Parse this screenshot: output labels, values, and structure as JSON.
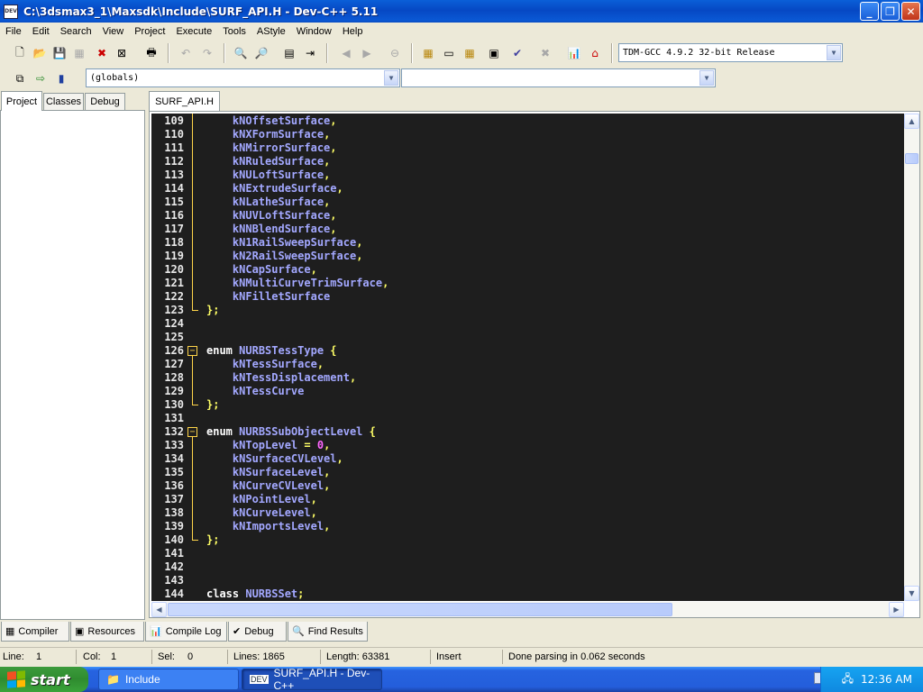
{
  "window": {
    "title": "C:\\3dsmax3_1\\Maxsdk\\Include\\SURF_API.H - Dev-C++ 5.11",
    "app_icon_label": "DEV"
  },
  "menu": [
    "File",
    "Edit",
    "Search",
    "View",
    "Project",
    "Execute",
    "Tools",
    "AStyle",
    "Window",
    "Help"
  ],
  "toolbar": {
    "compiler_select": "TDM-GCC 4.9.2 32-bit Release",
    "globals_select": "(globals)",
    "function_select": ""
  },
  "left_panel": {
    "tabs": [
      "Project",
      "Classes",
      "Debug"
    ],
    "active": "Project"
  },
  "editor": {
    "tab": "SURF_API.H",
    "lines": [
      {
        "n": "109",
        "text": "    kNOffsetSurface,"
      },
      {
        "n": "110",
        "text": "    kNXFormSurface,"
      },
      {
        "n": "111",
        "text": "    kNMirrorSurface,"
      },
      {
        "n": "112",
        "text": "    kNRuledSurface,"
      },
      {
        "n": "113",
        "text": "    kNULoftSurface,"
      },
      {
        "n": "114",
        "text": "    kNExtrudeSurface,"
      },
      {
        "n": "115",
        "text": "    kNLatheSurface,"
      },
      {
        "n": "116",
        "text": "    kNUVLoftSurface,"
      },
      {
        "n": "117",
        "text": "    kNNBlendSurface,"
      },
      {
        "n": "118",
        "text": "    kN1RailSweepSurface,"
      },
      {
        "n": "119",
        "text": "    kN2RailSweepSurface,"
      },
      {
        "n": "120",
        "text": "    kNCapSurface,"
      },
      {
        "n": "121",
        "text": "    kNMultiCurveTrimSurface,"
      },
      {
        "n": "122",
        "text": "    kNFilletSurface"
      },
      {
        "n": "123",
        "text": "};"
      },
      {
        "n": "124",
        "text": ""
      },
      {
        "n": "125",
        "text": ""
      },
      {
        "n": "126",
        "text": "enum NURBSTessType {"
      },
      {
        "n": "127",
        "text": "    kNTessSurface,"
      },
      {
        "n": "128",
        "text": "    kNTessDisplacement,"
      },
      {
        "n": "129",
        "text": "    kNTessCurve"
      },
      {
        "n": "130",
        "text": "};"
      },
      {
        "n": "131",
        "text": ""
      },
      {
        "n": "132",
        "text": "enum NURBSSubObjectLevel {"
      },
      {
        "n": "133",
        "text": "    kNTopLevel = 0,"
      },
      {
        "n": "134",
        "text": "    kNSurfaceCVLevel,"
      },
      {
        "n": "135",
        "text": "    kNSurfaceLevel,"
      },
      {
        "n": "136",
        "text": "    kNCurveCVLevel,"
      },
      {
        "n": "137",
        "text": "    kNPointLevel,"
      },
      {
        "n": "138",
        "text": "    kNCurveLevel,"
      },
      {
        "n": "139",
        "text": "    kNImportsLevel,"
      },
      {
        "n": "140",
        "text": "};"
      },
      {
        "n": "141",
        "text": ""
      },
      {
        "n": "142",
        "text": ""
      },
      {
        "n": "143",
        "text": ""
      },
      {
        "n": "144",
        "text": "class NURBSSet;"
      }
    ]
  },
  "bottom_tabs": [
    "Compiler",
    "Resources",
    "Compile Log",
    "Debug",
    "Find Results"
  ],
  "status": {
    "line_label": "Line:",
    "line": "1",
    "col_label": "Col:",
    "col": "1",
    "sel_label": "Sel:",
    "sel": "0",
    "lines": "Lines: 1865",
    "length": "Length: 63381",
    "mode": "Insert",
    "message": "Done parsing in 0.062 seconds"
  },
  "taskbar": {
    "start": "start",
    "items": [
      "Include",
      "SURF_API.H - Dev-C++"
    ],
    "clock": "12:36 AM"
  },
  "colors": {
    "editor_bg": "#1e1e1e",
    "identifier": "#a3a8ff",
    "keyword": "#ffffff",
    "symbol": "#ffff66",
    "number": "#ff66ff",
    "fold": "#ffd54a"
  }
}
